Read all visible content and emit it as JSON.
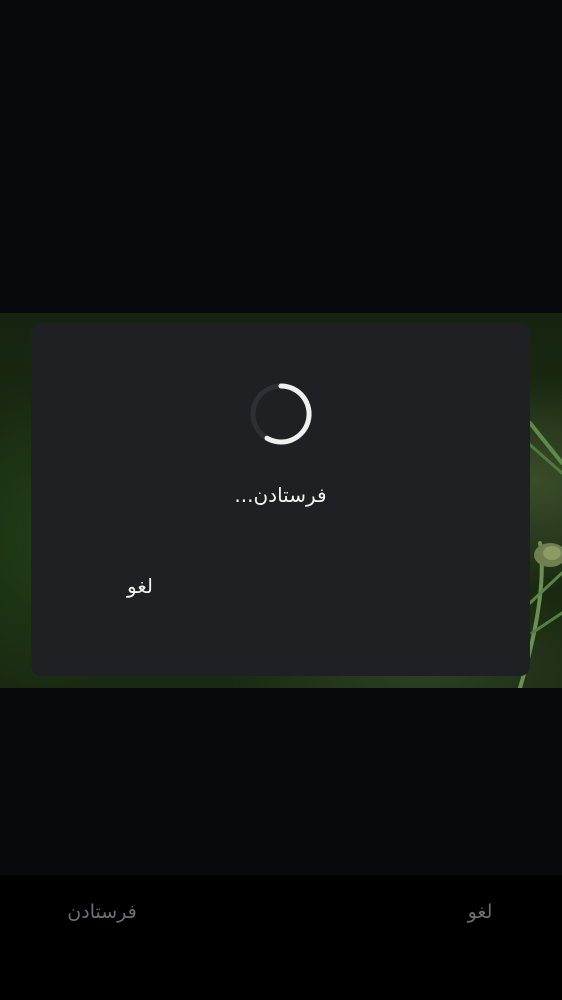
{
  "dialog": {
    "message": "فرستادن...",
    "cancel_label": "لغو",
    "spinner_icon": "loading-spinner-icon"
  },
  "bottom_bar": {
    "send_label": "فرستادن",
    "cancel_label": "لغو"
  },
  "colors": {
    "background": "#07090c",
    "dialog_background": "#1f2024",
    "dialog_text": "#f2f2f2",
    "bottom_bar_text": "#6d6f73",
    "spinner_track": "#2e3035",
    "spinner_arc": "#f0f0f0"
  }
}
